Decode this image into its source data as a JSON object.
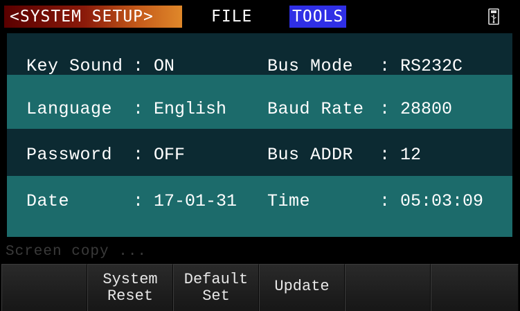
{
  "header": {
    "title": "<SYSTEM SETUP>",
    "menu_file": "FILE",
    "menu_tools": "TOOLS",
    "usb_icon": "usb-icon"
  },
  "settings": {
    "key_sound_label": "Key Sound",
    "key_sound_value": ": ON",
    "bus_mode_label": "Bus Mode",
    "bus_mode_value": ": RS232C",
    "language_label": "Language",
    "language_value": ": English",
    "baud_rate_label": "Baud Rate",
    "baud_rate_value": ": 28800",
    "password_label": "Password",
    "password_value": ": OFF",
    "bus_addr_label": "Bus ADDR",
    "bus_addr_value": ": 12",
    "date_label": "Date",
    "date_value": ": 17-01-31",
    "time_label": "Time",
    "time_value": ": 05:03:09"
  },
  "status": {
    "text": "Screen copy ..."
  },
  "softkeys": {
    "key1": "",
    "key2_line1": "System",
    "key2_line2": "Reset",
    "key3_line1": "Default",
    "key3_line2": "Set",
    "key4": "Update",
    "key5": "",
    "key6": ""
  },
  "colors": {
    "dark_band": "#0c2a32",
    "teal_band": "#1c6b6b",
    "tools_highlight": "#2f2fe6",
    "title_gradient_start": "#5a0000",
    "title_gradient_end": "#e0882a"
  }
}
